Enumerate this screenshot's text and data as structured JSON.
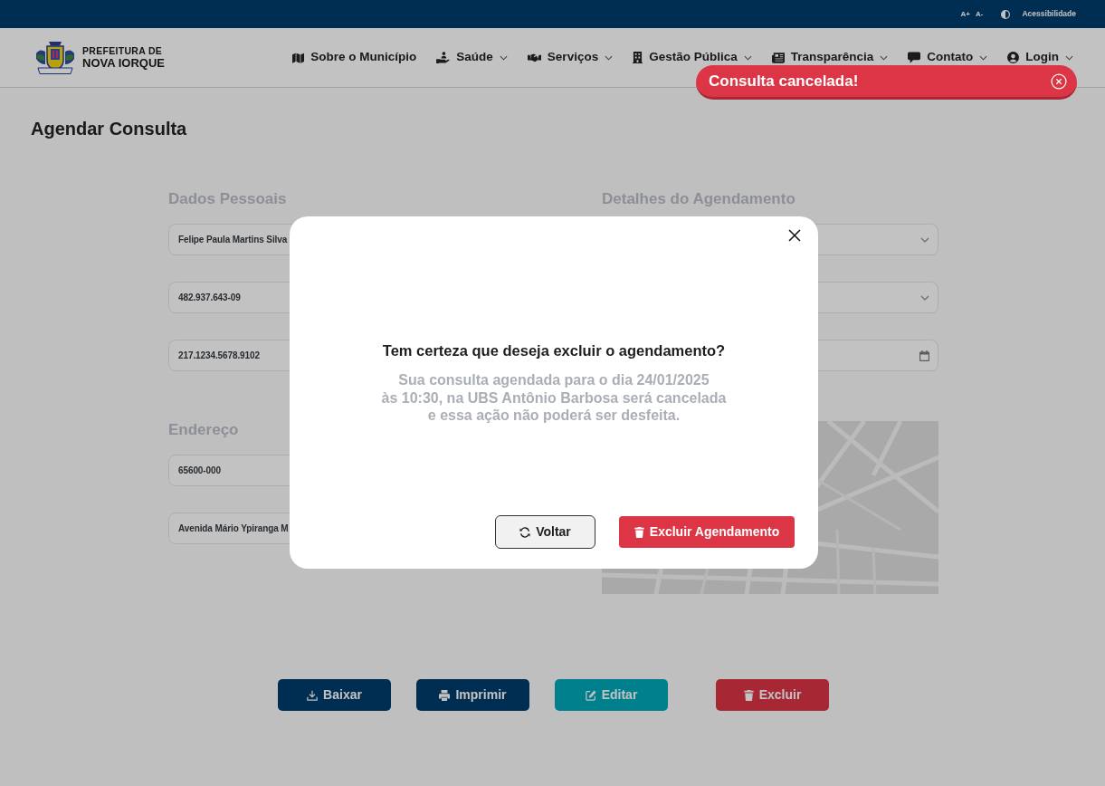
{
  "top_bar": {
    "font_size_controls": [
      "A+",
      "A-"
    ],
    "accessibility_link": "Acessibilidade"
  },
  "header": {
    "logo_lines": [
      "PREFEITURA DE",
      "NOVA IORQUE"
    ],
    "nav": [
      {
        "label": "Sobre o Município",
        "dropdown": false
      },
      {
        "label": "Saúde",
        "dropdown": true
      },
      {
        "label": "Serviços",
        "dropdown": true
      },
      {
        "label": "Gestão Pública",
        "dropdown": true
      },
      {
        "label": "Transparência",
        "dropdown": true
      },
      {
        "label": "Contato",
        "dropdown": true
      },
      {
        "label": "Login",
        "dropdown": true
      }
    ]
  },
  "page": {
    "title": "Agendar Consulta"
  },
  "personal_data": {
    "heading": "Dados Pessoais",
    "fields": [
      {
        "value": "Felipe Paula Martins Silva"
      },
      {
        "value": "482.937.643-09"
      },
      {
        "value": "217.1234.5678.9102"
      }
    ]
  },
  "address": {
    "heading": "Endereço",
    "fields": [
      {
        "value": "65600-000"
      },
      {
        "value": "Avenida Mário Ypiranga M"
      }
    ]
  },
  "appointment_details": {
    "heading": "Detalhes do Agendamento",
    "fields": [
      {
        "kind": "select"
      },
      {
        "kind": "select"
      },
      {
        "kind": "date"
      }
    ]
  },
  "actions": [
    {
      "label": "Baixar",
      "kind": "primary"
    },
    {
      "label": "Imprimir",
      "kind": "primary"
    },
    {
      "label": "Editar",
      "kind": "info"
    },
    {
      "label": "Excluir",
      "kind": "danger"
    }
  ],
  "modal": {
    "title": "Tem certeza que deseja excluir o agendamento?",
    "message": "Sua consulta agendada para o dia 24/01/2025\nàs 10:30, na UBS Antônio Barbosa será cancelada\ne essa ação não poderá ser desfeita.",
    "buttons": [
      {
        "label": "Voltar",
        "kind": "secondary"
      },
      {
        "label": "Excluir Agendamento",
        "kind": "danger"
      }
    ]
  },
  "toast": {
    "message": "Consulta cancelada!"
  }
}
